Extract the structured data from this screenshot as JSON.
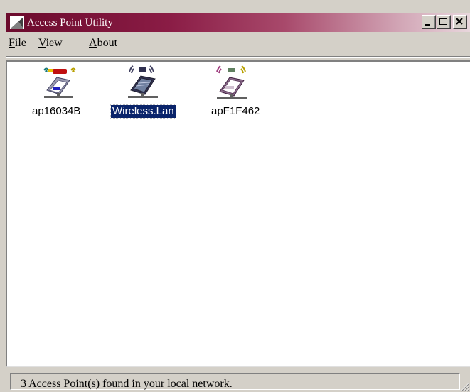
{
  "window": {
    "title": "Access Point Utility",
    "accent_color": "#6b0a2c"
  },
  "menu": {
    "items": [
      {
        "access_key": "F",
        "rest": "ile"
      },
      {
        "access_key": "V",
        "rest": "iew"
      },
      {
        "access_key": "A",
        "rest": "bout"
      }
    ]
  },
  "access_points": [
    {
      "label": "ap16034B",
      "icon": "access-point-icon",
      "selected": false
    },
    {
      "label": "Wireless.Lan",
      "icon": "access-point-icon",
      "selected": true
    },
    {
      "label": "apF1F462",
      "icon": "access-point-icon",
      "selected": false
    }
  ],
  "status": {
    "text": "3 Access Point(s) found in your local network."
  },
  "colors": {
    "selection_bg": "#0a246a",
    "face": "#d4d0c8"
  }
}
